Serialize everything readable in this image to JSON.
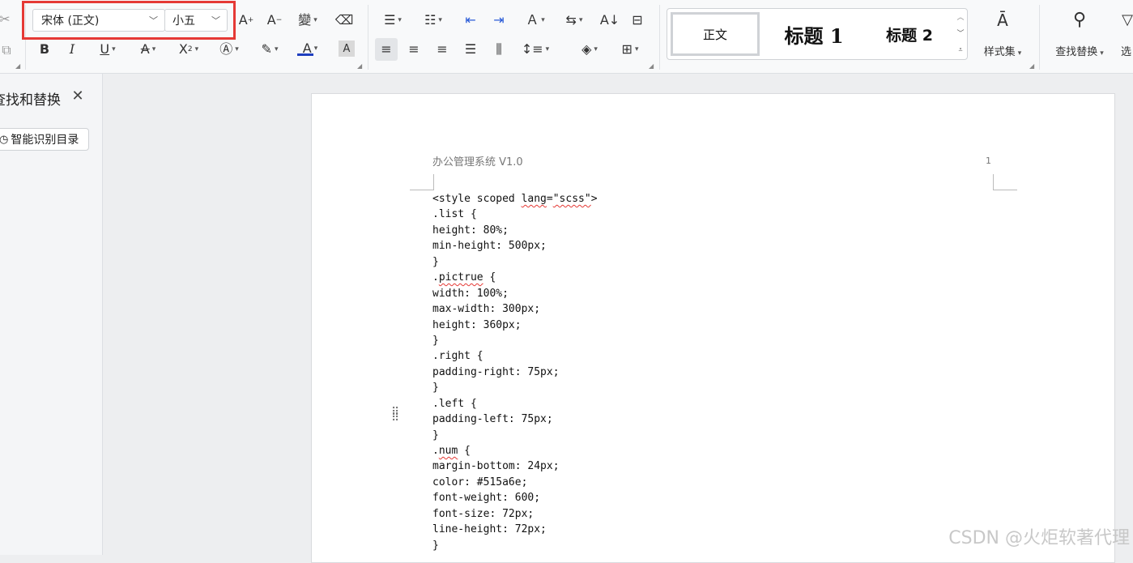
{
  "ribbon": {
    "font_name": "宋体 (正文)",
    "font_size": "小五",
    "styles": {
      "normal": "正文",
      "heading1": "标题 1",
      "heading2": "标题 2"
    },
    "style_set_label": "样式集",
    "find_replace_label": "查找替换",
    "select_label": "选"
  },
  "sidebar": {
    "title": "查找和替换",
    "smart_toc_button": "智能识别目录"
  },
  "document": {
    "header_text": "办公管理系统 V1.0",
    "page_number": "1",
    "code_lines": [
      "<style scoped lang=\"scss\">",
      ".list {",
      "height: 80%;",
      "min-height: 500px;",
      "}",
      ".pictrue {",
      "width: 100%;",
      "max-width: 300px;",
      "height: 360px;",
      "}",
      ".right {",
      "padding-right: 75px;",
      "}",
      ".left {",
      "padding-left: 75px;",
      "}",
      ".num {",
      "margin-bottom: 24px;",
      "color: #515a6e;",
      "font-weight: 600;",
      "font-size: 72px;",
      "line-height: 72px;",
      "}"
    ]
  },
  "watermark": "CSDN @火炬软著代理",
  "colors": {
    "highlight_box": "#e53935",
    "font_color_bar": "#1f3fbf"
  }
}
